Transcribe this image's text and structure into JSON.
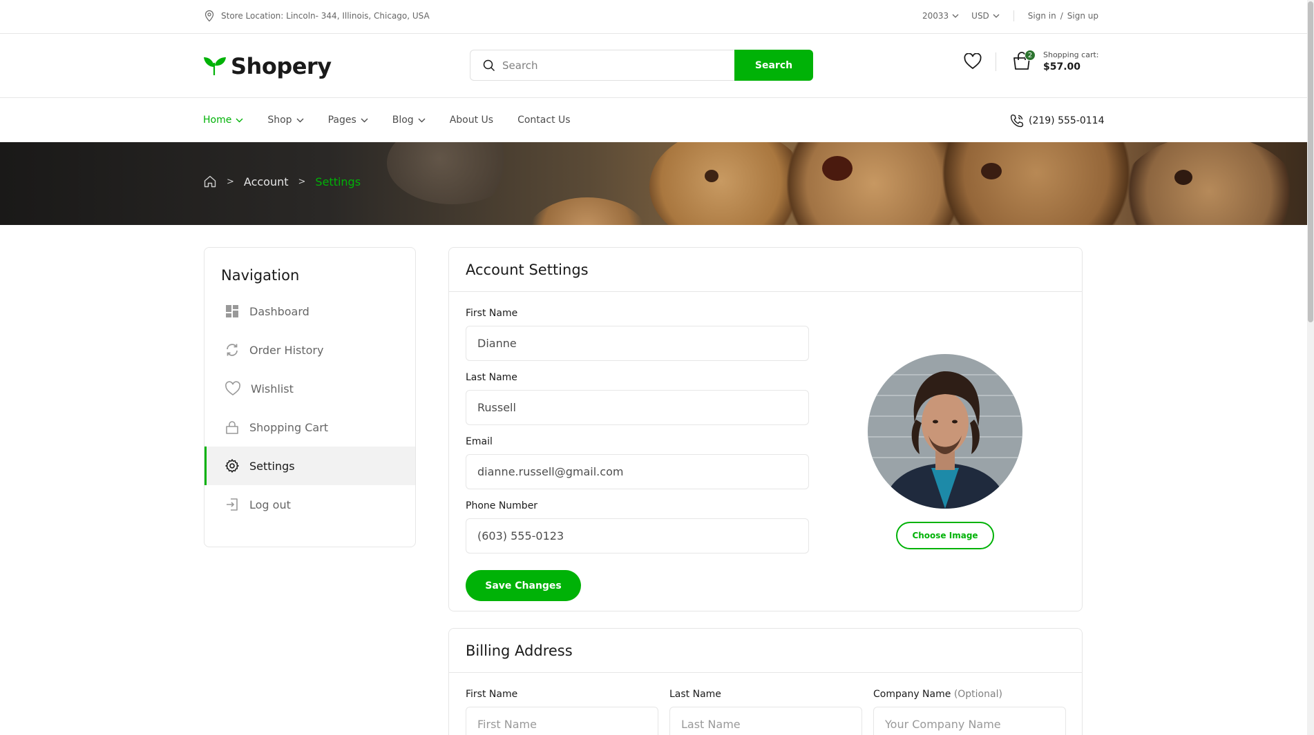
{
  "topbar": {
    "location": "Store Location: Lincoln- 344, Illinois, Chicago, USA",
    "language": "20033",
    "currency": "USD",
    "sign_in": "Sign in",
    "slash": "/",
    "sign_up": "Sign up"
  },
  "header": {
    "brand": "Shopery",
    "search_placeholder": "Search",
    "search_button": "Search",
    "cart_count": "2",
    "cart_label": "Shopping cart:",
    "cart_total": "$57.00"
  },
  "nav": {
    "items": [
      "Home",
      "Shop",
      "Pages",
      "Blog",
      "About Us",
      "Contact Us"
    ],
    "phone": "(219) 555-0114"
  },
  "breadcrumb": {
    "items": [
      "Account",
      "Settings"
    ]
  },
  "sidebar": {
    "title": "Navigation",
    "items": [
      "Dashboard",
      "Order History",
      "Wishlist",
      "Shopping Cart",
      "Settings",
      "Log out"
    ],
    "active": "Settings"
  },
  "account_settings": {
    "title": "Account Settings",
    "first_name_label": "First Name",
    "first_name_value": "Dianne",
    "last_name_label": "Last Name",
    "last_name_value": "Russell",
    "email_label": "Email",
    "email_value": "dianne.russell@gmail.com",
    "phone_label": "Phone Number",
    "phone_value": "(603) 555-0123",
    "save_button": "Save Changes",
    "choose_image_button": "Choose Image"
  },
  "billing_address": {
    "title": "Billing Address",
    "first_name_label": "First Name",
    "first_name_placeholder": "First Name",
    "last_name_label": "Last Name",
    "last_name_placeholder": "Last Name",
    "company_label": "Company Name",
    "company_optional": "(Optional)",
    "company_placeholder": "Your Company Name"
  },
  "colors": {
    "accent": "#00b207",
    "dark_accent": "#2c742f",
    "text": "#1a1a1a",
    "muted": "#666666",
    "border": "#e6e6e6"
  },
  "icons": [
    "map-pin-icon",
    "chevron-down-icon",
    "leaf-logo-icon",
    "search-icon",
    "heart-icon",
    "shopping-bag-icon",
    "phone-call-icon",
    "home-icon",
    "dashboard-icon",
    "refresh-icon",
    "lock-bag-icon",
    "gear-icon",
    "logout-icon"
  ]
}
